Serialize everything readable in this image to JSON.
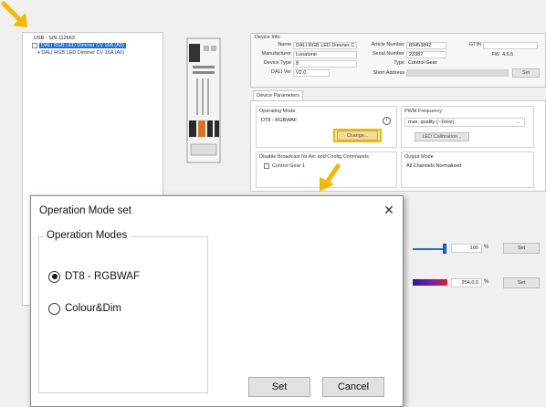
{
  "tree": {
    "root_label": "USB - S/N 112663",
    "selected_device": "DALI RGB LED Dimmer CV 16A (A0)",
    "child_device": "DALI RGB LED Dimmer CV 16A (A0)"
  },
  "device_info": {
    "section_title": "Device Info",
    "name_label": "Name",
    "name_value": "DALI RGB LED Dimmer C...",
    "manufacturer_label": "Manufacturer",
    "manufacturer_value": "Lunatone",
    "device_type_label": "Device Type",
    "device_type_value": "8",
    "dali_ver_label": "DALI Ver",
    "dali_ver_value": "V2.0",
    "article_number_label": "Article Number",
    "article_number_value": "89453842",
    "serial_number_label": "Serial Number",
    "serial_number_value": "23387",
    "type_label": "Type",
    "type_value": "Control Gear",
    "short_address_label": "Short Address",
    "gtin_label": "GTIN",
    "fw_label": "FW",
    "fw_value": "4.6.5",
    "set_label": "Set"
  },
  "parameters": {
    "tab_label": "Device Parameters",
    "operating_mode_title": "Operating Mode",
    "operating_mode_value": "DT8 - RGBWAF",
    "change_label": "Change...",
    "pwm_title": "PWM Frequency",
    "pwm_value": "max. quality (~1kHz)",
    "led_calibration_label": "LED Calibration...",
    "broadcast_title": "Disable Broadcast for Arc and Config Commands",
    "control_gear_label": "Control Gear 1",
    "output_mode_title": "Output Mode",
    "output_mode_value": "All Channels Normalized"
  },
  "controls": {
    "level_value": "100",
    "level_unit": "%",
    "level_fraction": 1.0,
    "color_value": "254,0,0",
    "color_unit": "%",
    "set_label": "Set"
  },
  "dialog": {
    "title": "Operation Mode set",
    "close_glyph": "✕",
    "group_title": "Operation Modes",
    "options": [
      {
        "label": "DT8 - RGBWAF",
        "selected": true
      },
      {
        "label": "Colour&Dim",
        "selected": false
      }
    ],
    "set_label": "Set",
    "cancel_label": "Cancel"
  },
  "colors": {
    "highlight": "#f5b800",
    "arrow": "#f5b800",
    "selection": "#1f6fd6"
  },
  "icons": [
    "arrow-pointer-icon",
    "info-icon",
    "close-icon",
    "dropdown-caret-icon"
  ]
}
